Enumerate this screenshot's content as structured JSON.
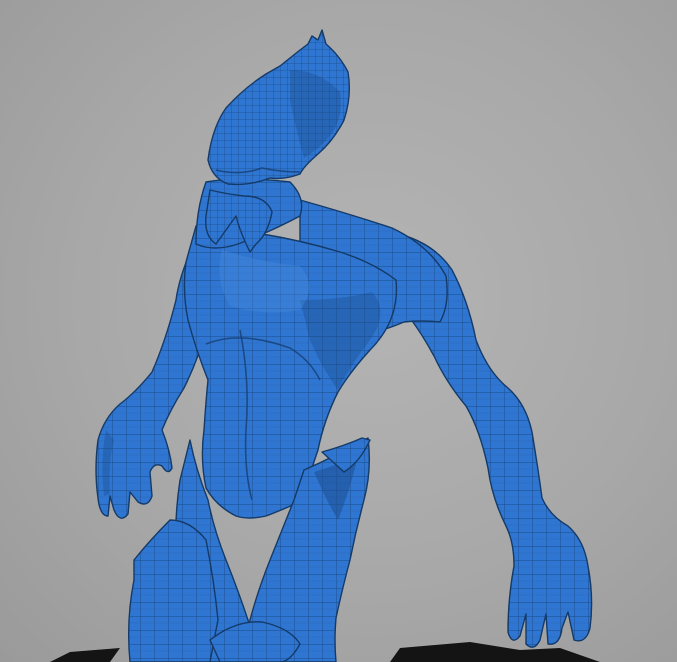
{
  "viewport": {
    "background_color": "#a9a9a9",
    "model": {
      "shading": "wireframe-on-shaded",
      "base_color": "#2f76d2",
      "wire_color": "#143a68"
    }
  }
}
